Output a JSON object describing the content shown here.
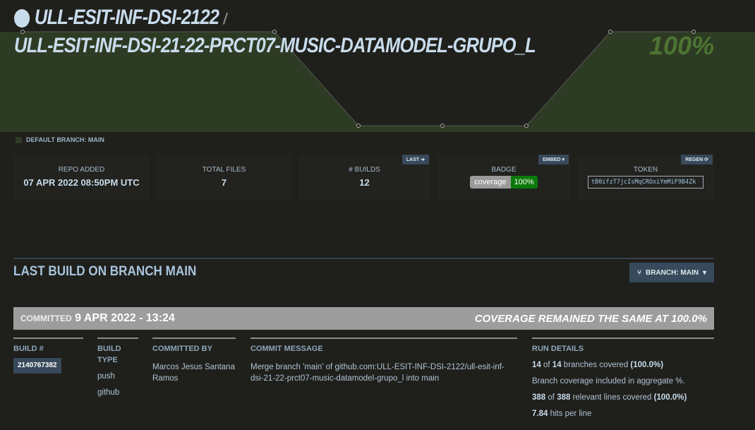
{
  "header": {
    "org": "ULL-ESIT-INF-DSI-2122",
    "separator": "/",
    "repo": "ULL-ESIT-INF-DSI-21-22-PRCT07-MUSIC-DATAMODEL-GRUPO_L",
    "coverage": "100%"
  },
  "colors": {
    "accent": "#37495a",
    "green_area": "#2e3b24",
    "badge_green": "#0b7a0b"
  },
  "default_branch": "DEFAULT BRANCH: MAIN",
  "cards": {
    "repo_added": {
      "label": "REPO ADDED",
      "value": "07 APR 2022 08:50PM UTC"
    },
    "total_files": {
      "label": "TOTAL FILES",
      "value": "7"
    },
    "builds": {
      "label": "# BUILDS",
      "value": "12",
      "button": "LAST"
    },
    "badge": {
      "label": "BADGE",
      "button": "EMBED",
      "left": "coverage",
      "right": "100%"
    },
    "token": {
      "label": "TOKEN",
      "button": "REGEN",
      "value": "tB0ifzT7jcIsMqCROxiYmMiF9B4Zk"
    }
  },
  "last_build": {
    "title": "LAST BUILD ON BRANCH MAIN",
    "branch_button": "BRANCH: MAIN",
    "committed_label": "COMMITTED",
    "committed_date": "9 APR 2022 - 13:24",
    "status": "COVERAGE REMAINED THE SAME AT 100.0%",
    "columns": {
      "build": "BUILD #",
      "type": "BUILD TYPE",
      "by": "COMMITTED BY",
      "msg": "COMMIT MESSAGE",
      "run": "RUN DETAILS"
    },
    "build_number": "2140767382",
    "build_type": [
      "push",
      "github"
    ],
    "committer": "Marcos Jesus Santana Ramos",
    "message": "Merge branch 'main' of github.com:ULL-ESIT-INF-DSI-2122/ull-esit-inf-dsi-21-22-prct07-music-datamodel-grupo_l into main",
    "run": {
      "b1": "14",
      "of": "of",
      "b2": "14",
      "branches": "branches covered",
      "bpct": "(100.0%)",
      "note": "Branch coverage included in aggregate %.",
      "l1": "388",
      "l2": "388",
      "lines": "relevant lines covered",
      "lpct": "(100.0%)",
      "hits": "7.84",
      "hits_label": "hits per line"
    }
  }
}
